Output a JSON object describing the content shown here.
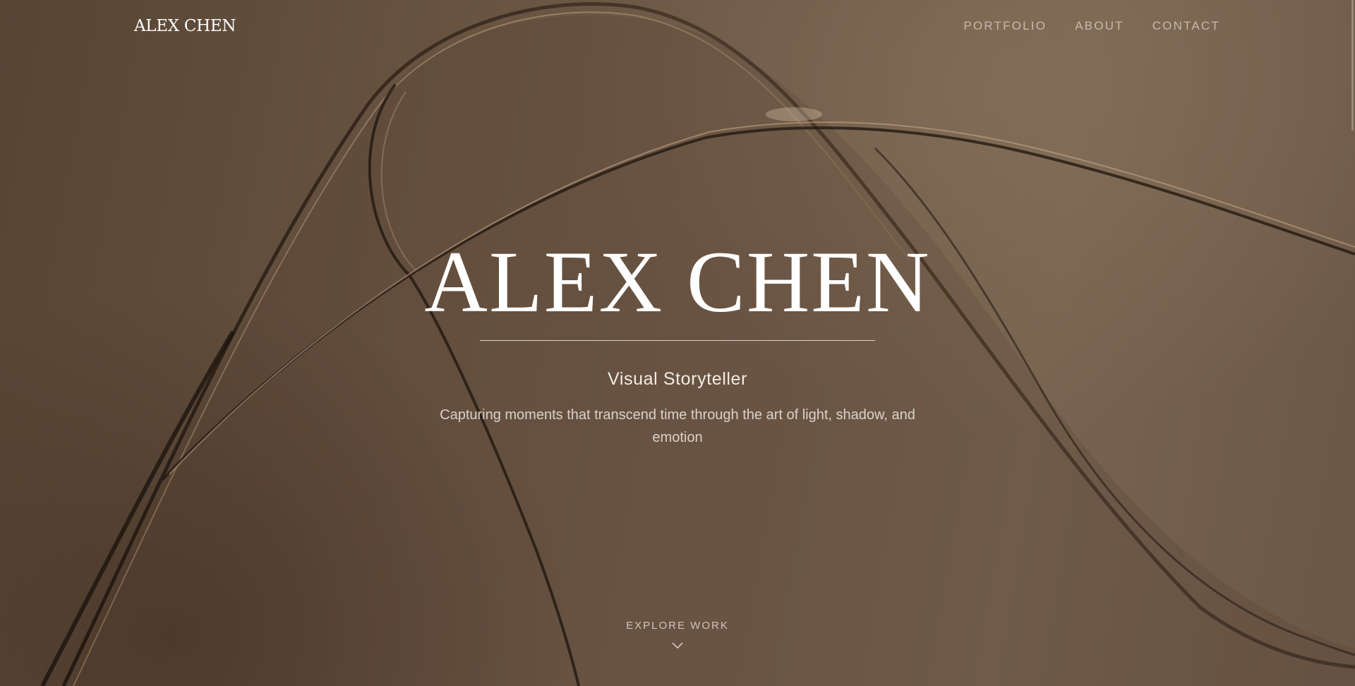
{
  "header": {
    "logo": "ALEX CHEN",
    "nav": [
      "PORTFOLIO",
      "ABOUT",
      "CONTACT"
    ]
  },
  "hero": {
    "title": "ALEX CHEN",
    "role": "Visual Storyteller",
    "tagline": "Capturing moments that transcend time through the art of light, shadow, and emotion"
  },
  "explore": {
    "label": "EXPLORE WORK",
    "icon": "chevron-down-icon"
  },
  "colors": {
    "background": "#6a5543",
    "text": "#ffffff",
    "muted_text": "#e1d7cd"
  }
}
